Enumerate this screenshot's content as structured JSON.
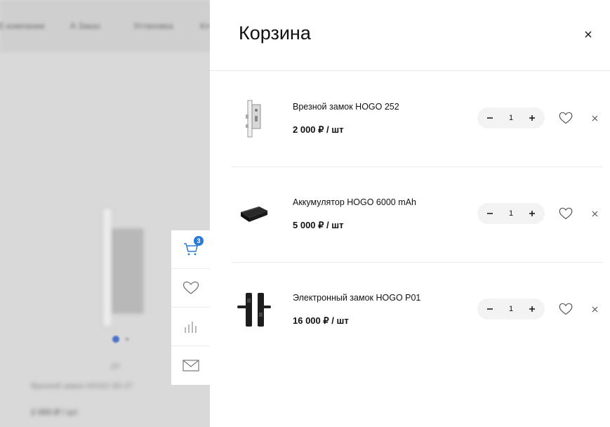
{
  "background": {
    "nav_items": [
      "Е-компании",
      "А Заказ",
      "Установка",
      "Кл"
    ],
    "product_caption": "Врезной замок HOGO 3D-27",
    "product_price": "2 000 ₽ / шт",
    "small_label": "ДА"
  },
  "toolbar": {
    "cart_badge": "3",
    "buttons": [
      "cart-icon",
      "heart-icon",
      "compare-icon",
      "mail-icon"
    ]
  },
  "cart": {
    "title": "Корзина",
    "items": [
      {
        "name": "Врезной замок HOGO 252",
        "price": "2 000 ₽ / шт",
        "quantity": "1",
        "image": "mortise-lock-icon"
      },
      {
        "name": "Аккумулятор HOGO 6000 mAh",
        "price": "5 000 ₽ / шт",
        "quantity": "1",
        "image": "battery-icon"
      },
      {
        "name": "Электронный замок HOGO P01",
        "price": "16 000 ₽ / шт",
        "quantity": "1",
        "image": "smart-lock-icon"
      }
    ]
  },
  "colors": {
    "accent": "#2a7bd8",
    "overlay": "#d6d6d6"
  }
}
